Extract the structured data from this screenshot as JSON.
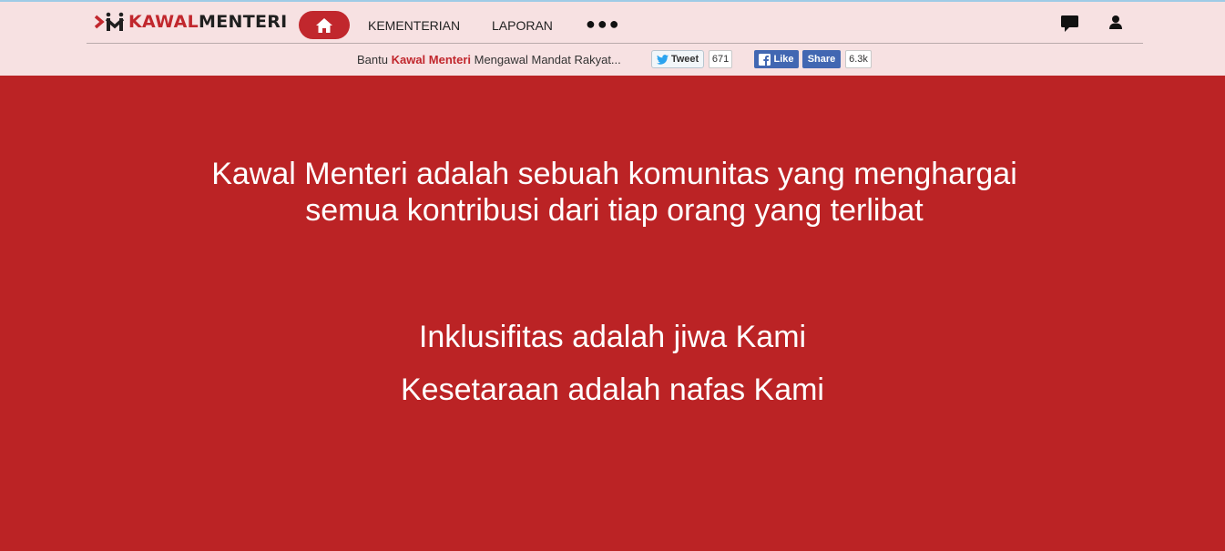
{
  "brand": {
    "name_part1": "KAWAL",
    "name_part2": "MENTERI",
    "accent_color": "#c1272d"
  },
  "nav": {
    "home_icon": "home-icon",
    "links": [
      "KEMENTERIAN",
      "LAPORAN"
    ],
    "more_label": "●●●",
    "comments_icon": "chat-icon",
    "account_icon": "user-icon"
  },
  "share": {
    "prefix": "Bantu ",
    "highlight": "Kawal Menteri",
    "suffix": " Mengawal Mandat Rakyat...",
    "tweet_label": "Tweet",
    "tweet_count": "671",
    "like_label": "Like",
    "share_label": "Share",
    "share_count": "6.3k"
  },
  "hero": {
    "headline_line1": "Kawal Menteri adalah sebuah komunitas yang menghargai",
    "headline_line2": "semua kontribusi dari tiap orang yang terlibat",
    "motto_line1": "Inklusifitas adalah jiwa Kami",
    "motto_line2": "Kesetaraan adalah nafas Kami",
    "background_color": "#bb2325"
  }
}
